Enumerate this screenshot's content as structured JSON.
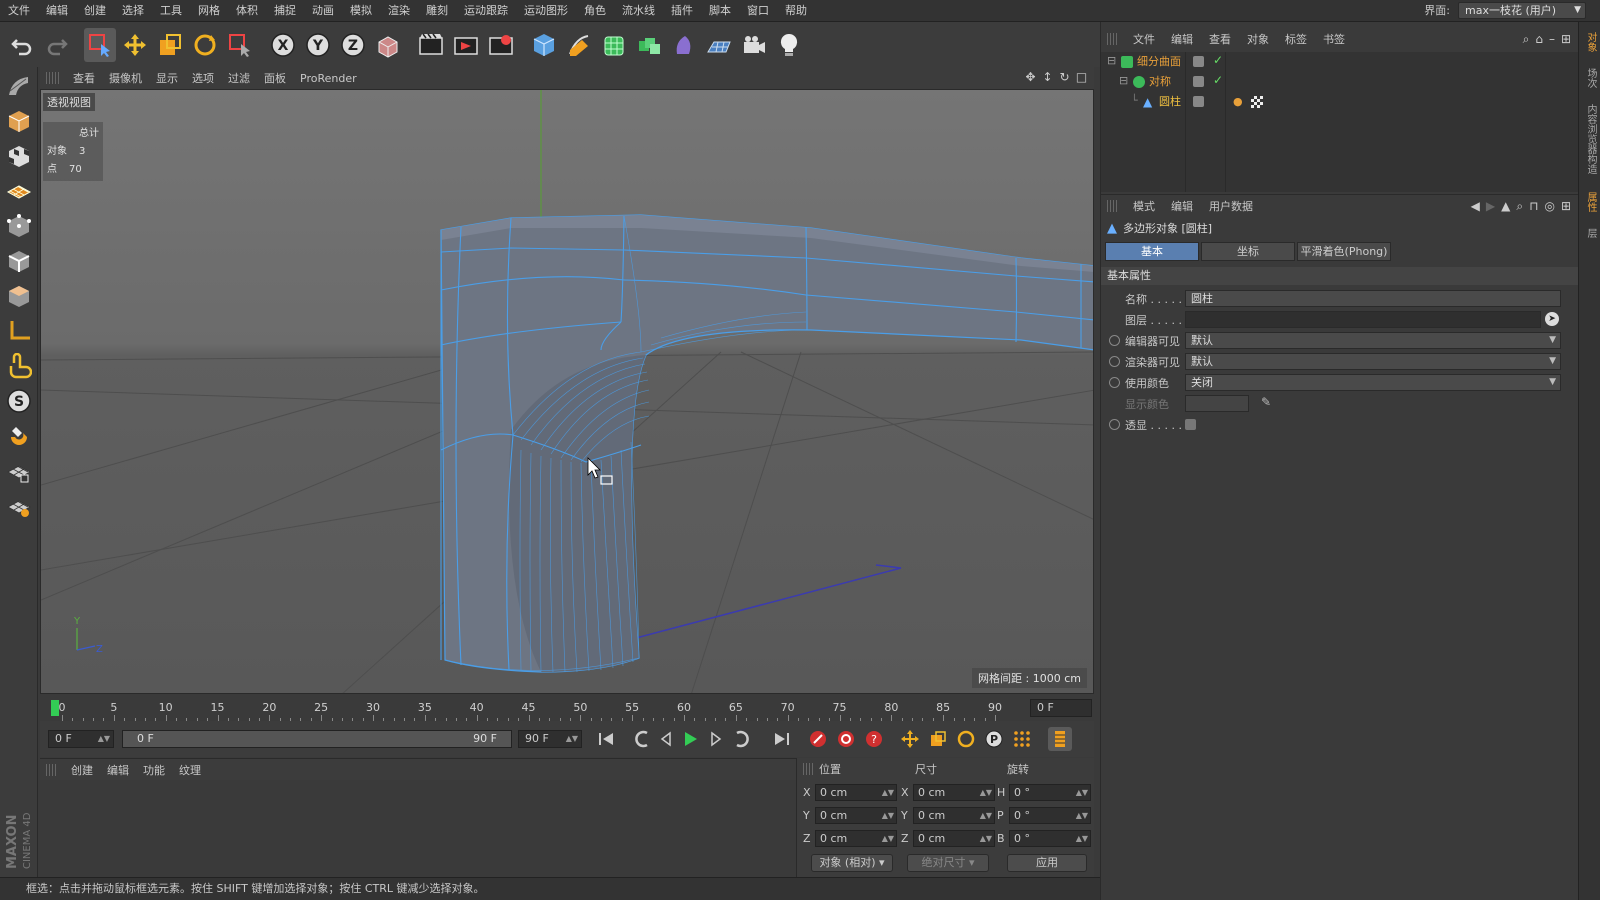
{
  "menubar": {
    "items": [
      "文件",
      "编辑",
      "创建",
      "选择",
      "工具",
      "网格",
      "体积",
      "捕捉",
      "动画",
      "模拟",
      "渲染",
      "雕刻",
      "运动跟踪",
      "运动图形",
      "角色",
      "流水线",
      "插件",
      "脚本",
      "窗口",
      "帮助"
    ],
    "layout_label": "界面:",
    "layout_value": "max一枝花 (用户)"
  },
  "toolbar": {
    "icons": [
      "undo-icon",
      "redo-icon",
      "live-select-icon",
      "move-icon",
      "scale-icon",
      "rotate-icon",
      "recent-tool-icon",
      "x-axis-lock-icon",
      "y-axis-lock-icon",
      "z-axis-lock-icon",
      "coordinate-system-icon",
      "render-view-icon",
      "render-picture-viewer-icon",
      "edit-render-settings-icon",
      "cube-icon",
      "pen-icon",
      "subdivision-surface-icon",
      "array-icon",
      "deformer-icon",
      "floor-icon",
      "camera-icon",
      "light-icon"
    ],
    "axis_labels": [
      "X",
      "Y",
      "Z"
    ]
  },
  "left_tools": {
    "icons": [
      "make-editable-icon",
      "model-mode-icon",
      "texture-mode-icon",
      "workplane-icon",
      "points-mode-icon",
      "edges-mode-icon",
      "polygons-mode-icon",
      "axis-mode-icon",
      "tweak-mode-icon",
      "solo-mode-icon",
      "magnet-icon",
      "snap-grid-icon",
      "snap-settings-icon"
    ],
    "solo_label": "S",
    "brand_line1": "MAXON",
    "brand_line2": "CINEMA 4D"
  },
  "viewport": {
    "menu": [
      "查看",
      "摄像机",
      "显示",
      "选项",
      "过滤",
      "面板",
      "ProRender"
    ],
    "title": "透视视图",
    "stats": {
      "header": "总计",
      "objects_label": "对象",
      "objects_value": "3",
      "points_label": "点",
      "points_value": "70"
    },
    "grid_info": "网格间距 : 1000 cm",
    "axis_y": "Y",
    "axis_z": "Z"
  },
  "timeline": {
    "ticks": [
      "0",
      "5",
      "10",
      "15",
      "20",
      "25",
      "30",
      "35",
      "40",
      "45",
      "50",
      "55",
      "60",
      "65",
      "70",
      "75",
      "80",
      "85",
      "90"
    ],
    "current_frame": "0 F"
  },
  "playback": {
    "start_field": "0 F",
    "range_start": "0 F",
    "range_end": "90 F",
    "end_field": "90 F"
  },
  "material_manager": {
    "menu": [
      "创建",
      "编辑",
      "功能",
      "纹理"
    ]
  },
  "coordinates": {
    "headers": [
      "位置",
      "尺寸",
      "旋转"
    ],
    "rows": [
      {
        "axis": "X",
        "pos": "0 cm",
        "size_axis": "X",
        "size": "0 cm",
        "rot_axis": "H",
        "rot": "0 °"
      },
      {
        "axis": "Y",
        "pos": "0 cm",
        "size_axis": "Y",
        "size": "0 cm",
        "rot_axis": "P",
        "rot": "0 °"
      },
      {
        "axis": "Z",
        "pos": "0 cm",
        "size_axis": "Z",
        "size": "0 cm",
        "rot_axis": "B",
        "rot": "0 °"
      }
    ],
    "mode_select": "对象 (相对)",
    "size_select": "绝对尺寸",
    "apply_button": "应用"
  },
  "status_bar": "框选：点击并拖动鼠标框选元素。按住 SHIFT 键增加选择对象；按住 CTRL 键减少选择对象。",
  "object_manager": {
    "menu": [
      "文件",
      "编辑",
      "查看",
      "对象",
      "标签",
      "书签"
    ],
    "objects": [
      {
        "name": "细分曲面",
        "color": "#e8a03a"
      },
      {
        "name": "对称",
        "color": "#e8a03a"
      },
      {
        "name": "圆柱",
        "color": "#f0c040"
      }
    ]
  },
  "attribute_manager": {
    "menu": [
      "模式",
      "编辑",
      "用户数据"
    ],
    "title": "多边形对象 [圆柱]",
    "tabs": [
      "基本",
      "坐标",
      "平滑着色(Phong)"
    ],
    "section": "基本属性",
    "fields": [
      {
        "label": "名称 . . . . . .",
        "value": "圆柱"
      },
      {
        "label": "图层 . . . . . .",
        "value": ""
      },
      {
        "label": "编辑器可见",
        "value": "默认"
      },
      {
        "label": "渲染器可见",
        "value": "默认"
      },
      {
        "label": "使用颜色",
        "value": "关闭"
      },
      {
        "label": "显示颜色",
        "value": ""
      },
      {
        "label": "透显 . . . . . .",
        "value": ""
      }
    ]
  },
  "side_tabs": [
    "对象",
    "场次",
    "内容浏览器",
    "构造",
    "属性",
    "层"
  ],
  "colors": {
    "accent_blue": "#5a7fb0",
    "playhead_green": "#33cc55",
    "object_orange": "#e8a03a"
  }
}
